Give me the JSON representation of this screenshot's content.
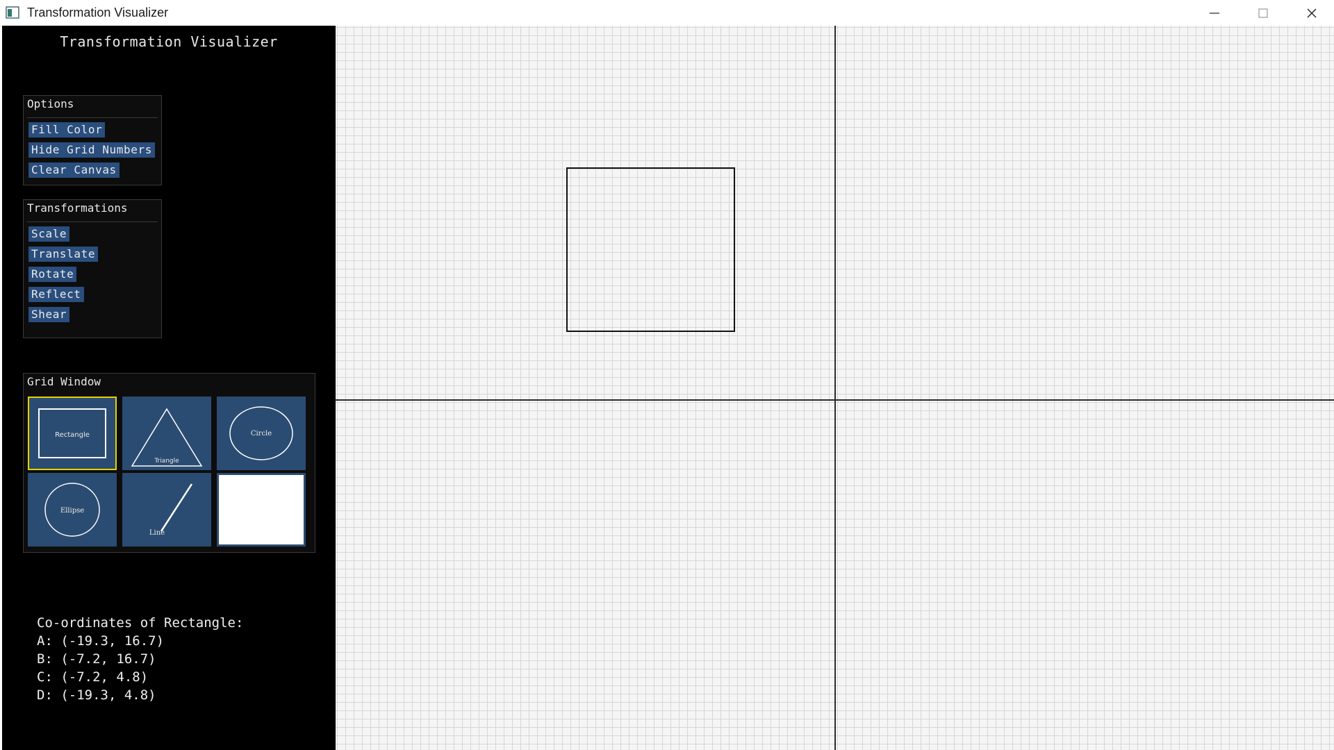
{
  "window": {
    "title": "Transformation Visualizer",
    "controls": {
      "minimize": "—",
      "maximize": "☐",
      "close": "✕"
    }
  },
  "sidebar": {
    "title": "Transformation Visualizer",
    "options": {
      "title": "Options",
      "buttons": [
        "Fill Color",
        "Hide Grid Numbers",
        "Clear Canvas"
      ]
    },
    "transformations": {
      "title": "Transformations",
      "buttons": [
        "Scale",
        "Translate",
        "Rotate",
        "Reflect",
        "Shear"
      ]
    },
    "grid_window": {
      "title": "Grid Window",
      "tiles": [
        "Rectangle",
        "Triangle",
        "Circle",
        "Ellipse",
        "Line",
        ""
      ],
      "selected": "Rectangle"
    },
    "coordinates": {
      "heading": "Co-ordinates of Rectangle:",
      "points": [
        "A: (-19.3, 16.7)",
        "B: (-7.2, 16.7)",
        "C: (-7.2, 4.8)",
        "D: (-19.3, 4.8)"
      ]
    }
  },
  "colors": {
    "button": "#2a4e7d",
    "tile": "#2b4c72",
    "selection": "#e6d200",
    "canvas": "#f5f5f5",
    "grid": "#d6d6d6"
  },
  "icons": [
    "app-icon",
    "minimize-icon",
    "maximize-icon",
    "close-icon"
  ]
}
